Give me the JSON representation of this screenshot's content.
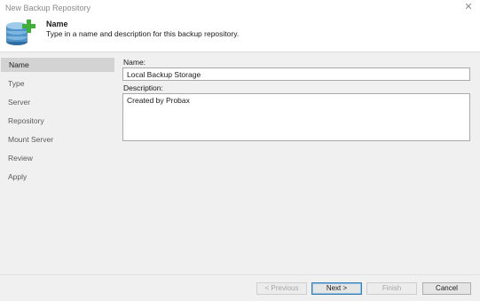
{
  "window": {
    "title": "New Backup Repository",
    "close_glyph": "✕"
  },
  "header": {
    "icon": "database-add-icon",
    "step_title": "Name",
    "step_description": "Type in a name and description for this backup repository."
  },
  "sidebar": {
    "items": [
      {
        "label": "Name",
        "active": true
      },
      {
        "label": "Type"
      },
      {
        "label": "Server"
      },
      {
        "label": "Repository"
      },
      {
        "label": "Mount Server"
      },
      {
        "label": "Review"
      },
      {
        "label": "Apply"
      }
    ]
  },
  "form": {
    "name_label": "Name:",
    "name_value": "Local Backup Storage",
    "description_label": "Description:",
    "description_value": "Created by Probax"
  },
  "footer": {
    "previous_label": "< Previous",
    "next_label": "Next >",
    "finish_label": "Finish",
    "cancel_label": "Cancel"
  },
  "colors": {
    "accent_plus": "#3fae3a",
    "database_blue": "#4f93c9",
    "selected_nav": "#d3d3d3",
    "panel_bg": "#f0f0f0"
  }
}
